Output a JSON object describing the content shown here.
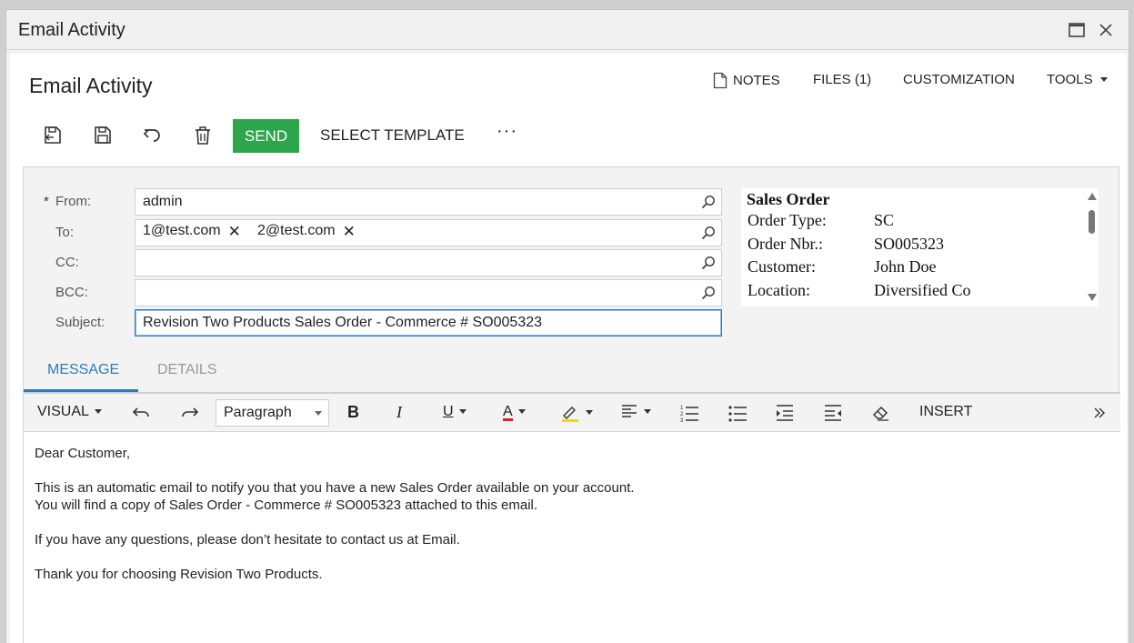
{
  "window": {
    "title": "Email Activity"
  },
  "page": {
    "title": "Email Activity"
  },
  "top_links": {
    "notes": "NOTES",
    "files": "FILES (1)",
    "customization": "CUSTOMIZATION",
    "tools": "TOOLS"
  },
  "toolbar": {
    "send": "SEND",
    "select_template": "SELECT TEMPLATE",
    "more": "···"
  },
  "form": {
    "required_mark": "*",
    "from_label": "From:",
    "from_value": "admin",
    "to_label": "To:",
    "to_recipients": [
      "1@test.com",
      "2@test.com"
    ],
    "cc_label": "CC:",
    "cc_value": "",
    "bcc_label": "BCC:",
    "bcc_value": "",
    "subject_label": "Subject:",
    "subject_value": "Revision Two Products Sales Order - Commerce # SO005323"
  },
  "summary": {
    "title": "Sales Order",
    "rows": [
      {
        "label": "Order Type:",
        "value": "SC"
      },
      {
        "label": "Order Nbr.:",
        "value": "SO005323"
      },
      {
        "label": "Customer:",
        "value": "John Doe"
      },
      {
        "label": "Location:",
        "value": "Diversified Co"
      }
    ]
  },
  "tabs": {
    "message": "MESSAGE",
    "details": "DETAILS",
    "active": "MESSAGE"
  },
  "editor_toolbar": {
    "mode": "VISUAL",
    "paragraph": "Paragraph",
    "insert": "INSERT",
    "bold": "B",
    "italic": "I",
    "underline": "U",
    "font_color": "A"
  },
  "message": {
    "greeting": "Dear Customer,",
    "line1": "This is an automatic email to notify you that you have a new Sales Order available on your account.",
    "line2": "You will find a copy of Sales Order - Commerce # SO005323 attached to this email.",
    "line3": "If you have any questions, please don’t hesitate to contact us at Email.",
    "line4": "Thank you for choosing Revision Two Products."
  },
  "colors": {
    "accent": "#2f7bb8",
    "send_button": "#2da54a",
    "font_color_bar": "#e02020",
    "highlight_bar": "#f2d22e"
  }
}
